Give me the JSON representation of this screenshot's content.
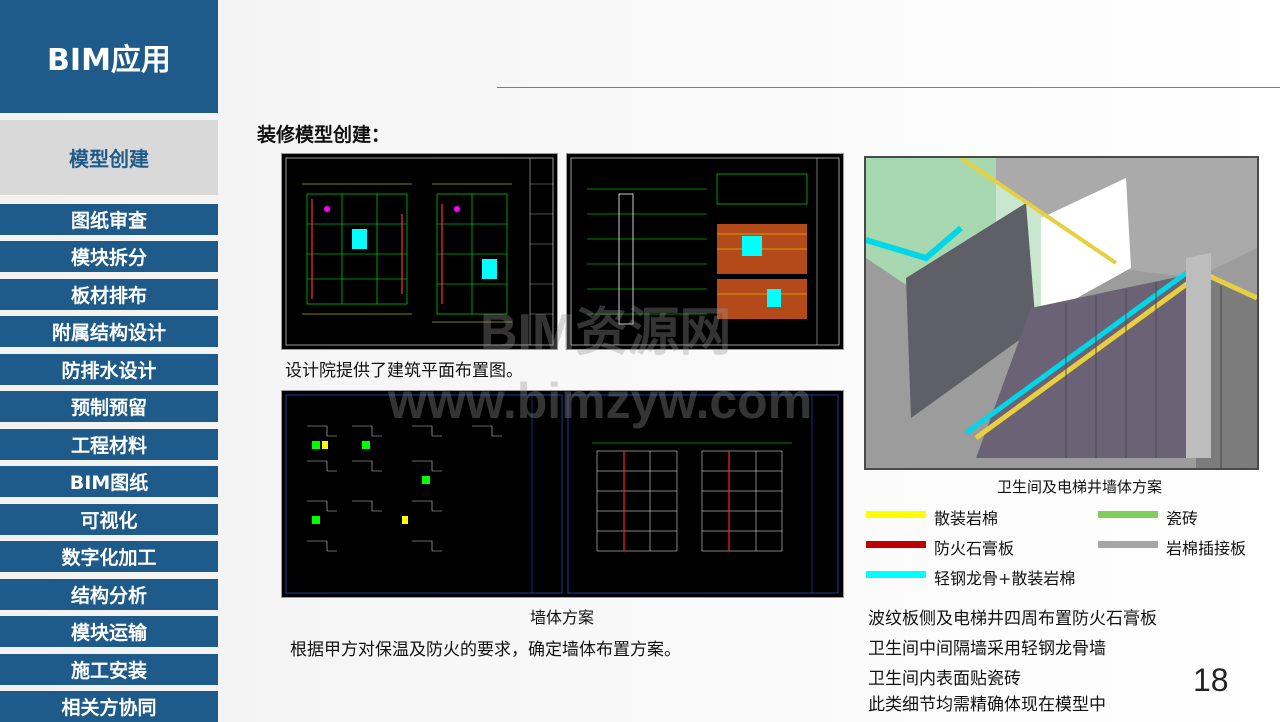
{
  "sidebar": {
    "title": "BIM应用",
    "active_item": "模型创建",
    "items": [
      {
        "label": "图纸审查"
      },
      {
        "label": "模块拆分"
      },
      {
        "label": "板材排布"
      },
      {
        "label": "附属结构设计"
      },
      {
        "label": "防排水设计"
      },
      {
        "label": "预制预留"
      },
      {
        "label": "工程材料"
      },
      {
        "label": "BIM图纸"
      },
      {
        "label": "可视化"
      },
      {
        "label": "数字化加工"
      },
      {
        "label": "结构分析"
      },
      {
        "label": "模块运输"
      },
      {
        "label": "施工安装"
      },
      {
        "label": "相关方协同"
      }
    ]
  },
  "main": {
    "section_title": "装修模型创建：",
    "caption_plan": "设计院提供了建筑平面布置图。",
    "caption_wall": "墙体方案",
    "caption_wall_desc": "根据甲方对保温及防火的要求，确定墙体布置方案。",
    "caption_3d": "卫生间及电梯井墙体方案",
    "legend": [
      {
        "label": "散装岩棉",
        "color": "#ffff00"
      },
      {
        "label": "瓷砖",
        "color": "#7fcf5a"
      },
      {
        "label": "防火石膏板",
        "color": "#c00000"
      },
      {
        "label": "岩棉插接板",
        "color": "#a6a6a6"
      },
      {
        "label": "轻钢龙骨+散装岩棉",
        "color": "#00ffff"
      }
    ],
    "notes": [
      "波纹板侧及电梯井四周布置防火石膏板",
      "卫生间中间隔墙采用轻钢龙骨墙",
      "卫生间内表面贴瓷砖",
      "此类细节均需精确体现在模型中"
    ]
  },
  "watermark": {
    "line1": "BIM资源网",
    "line2": "www.bimzyw.com"
  },
  "page_number": "18",
  "colors": {
    "brand": "#1f5b8a",
    "active_bg": "#d9d9d9",
    "header_line": "#4a8bbf"
  }
}
